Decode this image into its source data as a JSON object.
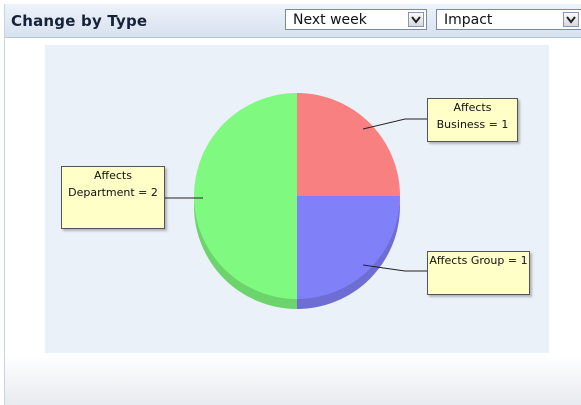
{
  "widget": {
    "title": "Change by Type",
    "period_select": {
      "value": "Next week"
    },
    "metric_select": {
      "value": "Impact"
    }
  },
  "chart_data": {
    "type": "pie",
    "slices": [
      {
        "label": "Affects Business",
        "value": 1,
        "color": "#f98080",
        "callout": "Affects Business = 1"
      },
      {
        "label": "Affects Group",
        "value": 1,
        "color": "#8080f9",
        "callout": "Affects Group = 1"
      },
      {
        "label": "Affects Department",
        "value": 2,
        "color": "#80f980",
        "callout": "Affects Department = 2"
      }
    ]
  }
}
